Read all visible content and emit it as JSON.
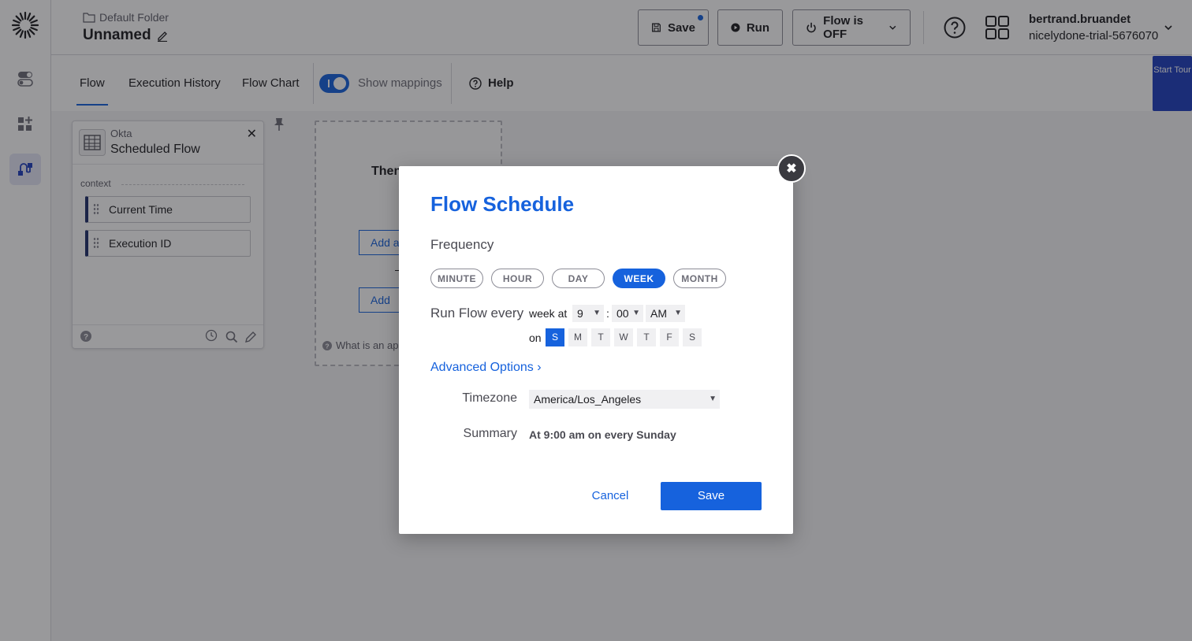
{
  "header": {
    "folder": "Default Folder",
    "flow_name": "Unnamed",
    "save_label": "Save",
    "run_label": "Run",
    "flow_status_label": "Flow is OFF",
    "user_name": "bertrand.bruandet",
    "org_name": "nicelydone-trial-5676070"
  },
  "subnav": {
    "tabs": [
      {
        "label": "Flow",
        "active": true
      },
      {
        "label": "Execution History",
        "active": false
      },
      {
        "label": "Flow Chart",
        "active": false
      }
    ],
    "show_mappings_label": "Show mappings",
    "show_mappings_on": true,
    "help_label": "Help",
    "start_tour_label": "Start Tour"
  },
  "card": {
    "vendor": "Okta",
    "title": "Scheduled Flow",
    "context_label": "context",
    "items": [
      "Current Time",
      "Execution ID"
    ]
  },
  "then_card": {
    "title": "Then",
    "add_action_label": "Add a",
    "add_function_label": "Add",
    "help_text": "What is an ap"
  },
  "modal": {
    "title": "Flow Schedule",
    "frequency_label": "Frequency",
    "frequencies": [
      {
        "label": "MINUTE",
        "active": false
      },
      {
        "label": "HOUR",
        "active": false
      },
      {
        "label": "DAY",
        "active": false
      },
      {
        "label": "WEEK",
        "active": true
      },
      {
        "label": "MONTH",
        "active": false
      }
    ],
    "run_every_label": "Run Flow every",
    "week_at_label": "week at",
    "hour_value": "9",
    "time_separator": ":",
    "minute_value": "00",
    "ampm_value": "AM",
    "on_label": "on",
    "days": [
      {
        "label": "S",
        "active": true
      },
      {
        "label": "M",
        "active": false
      },
      {
        "label": "T",
        "active": false
      },
      {
        "label": "W",
        "active": false
      },
      {
        "label": "T",
        "active": false
      },
      {
        "label": "F",
        "active": false
      },
      {
        "label": "S",
        "active": false
      }
    ],
    "advanced_options_label": "Advanced Options",
    "timezone_label": "Timezone",
    "timezone_value": "America/Los_Angeles",
    "summary_label": "Summary",
    "summary_value": "At 9:00 am on every Sunday",
    "cancel_label": "Cancel",
    "save_label": "Save"
  },
  "colors": {
    "accent": "#1662dd",
    "nav_dark": "#1f2f6b",
    "start_tour_bg": "#1f3fbf"
  }
}
